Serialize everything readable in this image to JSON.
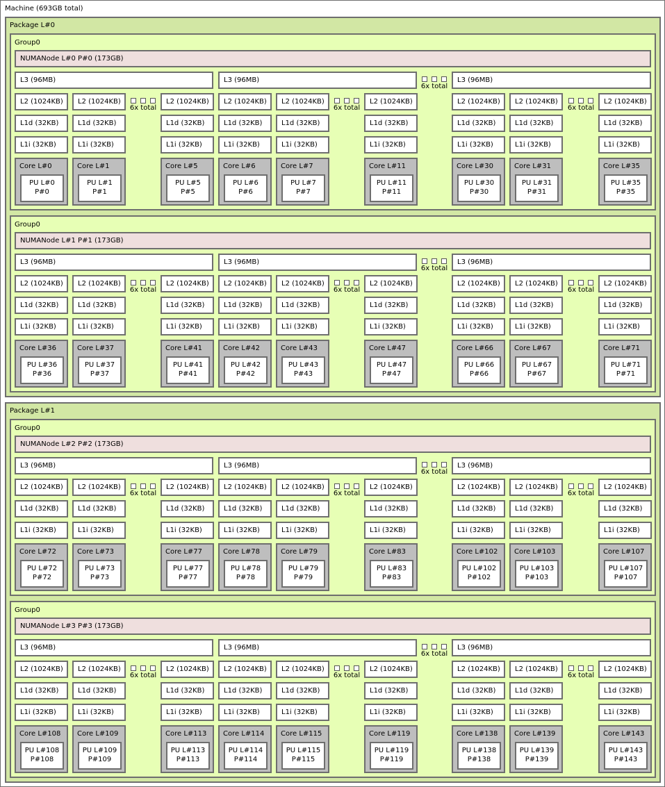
{
  "machine": {
    "label": "Machine (693GB total)"
  },
  "colors": {
    "package_bg": "#d2e7a4",
    "group_bg": "#e7ffb5",
    "numa_bg": "#efdfde",
    "core_bg": "#bebebe",
    "cache_bg": "#ffffff",
    "border": "#6e6e6e"
  },
  "ellipsis_label": "6x total",
  "packages": [
    {
      "label": "Package L#0",
      "groups": [
        {
          "label": "Group0",
          "numa": "NUMANode L#0 P#0 (173GB)",
          "l3": [
            "L3 (96MB)",
            "L3 (96MB)",
            "L3 (96MB)"
          ],
          "l2": "L2 (1024KB)",
          "l1d": "L1d (32KB)",
          "l1i": "L1i (32KB)",
          "cores": [
            {
              "core": "Core L#0",
              "pu": "PU L#0",
              "p": "P#0"
            },
            {
              "core": "Core L#1",
              "pu": "PU L#1",
              "p": "P#1"
            },
            {
              "core": "Core L#5",
              "pu": "PU L#5",
              "p": "P#5"
            },
            {
              "core": "Core L#6",
              "pu": "PU L#6",
              "p": "P#6"
            },
            {
              "core": "Core L#7",
              "pu": "PU L#7",
              "p": "P#7"
            },
            {
              "core": "Core L#11",
              "pu": "PU L#11",
              "p": "P#11"
            },
            {
              "core": "Core L#30",
              "pu": "PU L#30",
              "p": "P#30"
            },
            {
              "core": "Core L#31",
              "pu": "PU L#31",
              "p": "P#31"
            },
            {
              "core": "Core L#35",
              "pu": "PU L#35",
              "p": "P#35"
            }
          ]
        },
        {
          "label": "Group0",
          "numa": "NUMANode L#1 P#1 (173GB)",
          "l3": [
            "L3 (96MB)",
            "L3 (96MB)",
            "L3 (96MB)"
          ],
          "l2": "L2 (1024KB)",
          "l1d": "L1d (32KB)",
          "l1i": "L1i (32KB)",
          "cores": [
            {
              "core": "Core L#36",
              "pu": "PU L#36",
              "p": "P#36"
            },
            {
              "core": "Core L#37",
              "pu": "PU L#37",
              "p": "P#37"
            },
            {
              "core": "Core L#41",
              "pu": "PU L#41",
              "p": "P#41"
            },
            {
              "core": "Core L#42",
              "pu": "PU L#42",
              "p": "P#42"
            },
            {
              "core": "Core L#43",
              "pu": "PU L#43",
              "p": "P#43"
            },
            {
              "core": "Core L#47",
              "pu": "PU L#47",
              "p": "P#47"
            },
            {
              "core": "Core L#66",
              "pu": "PU L#66",
              "p": "P#66"
            },
            {
              "core": "Core L#67",
              "pu": "PU L#67",
              "p": "P#67"
            },
            {
              "core": "Core L#71",
              "pu": "PU L#71",
              "p": "P#71"
            }
          ]
        }
      ]
    },
    {
      "label": "Package L#1",
      "groups": [
        {
          "label": "Group0",
          "numa": "NUMANode L#2 P#2 (173GB)",
          "l3": [
            "L3 (96MB)",
            "L3 (96MB)",
            "L3 (96MB)"
          ],
          "l2": "L2 (1024KB)",
          "l1d": "L1d (32KB)",
          "l1i": "L1i (32KB)",
          "cores": [
            {
              "core": "Core L#72",
              "pu": "PU L#72",
              "p": "P#72"
            },
            {
              "core": "Core L#73",
              "pu": "PU L#73",
              "p": "P#73"
            },
            {
              "core": "Core L#77",
              "pu": "PU L#77",
              "p": "P#77"
            },
            {
              "core": "Core L#78",
              "pu": "PU L#78",
              "p": "P#78"
            },
            {
              "core": "Core L#79",
              "pu": "PU L#79",
              "p": "P#79"
            },
            {
              "core": "Core L#83",
              "pu": "PU L#83",
              "p": "P#83"
            },
            {
              "core": "Core L#102",
              "pu": "PU L#102",
              "p": "P#102"
            },
            {
              "core": "Core L#103",
              "pu": "PU L#103",
              "p": "P#103"
            },
            {
              "core": "Core L#107",
              "pu": "PU L#107",
              "p": "P#107"
            }
          ]
        },
        {
          "label": "Group0",
          "numa": "NUMANode L#3 P#3 (173GB)",
          "l3": [
            "L3 (96MB)",
            "L3 (96MB)",
            "L3 (96MB)"
          ],
          "l2": "L2 (1024KB)",
          "l1d": "L1d (32KB)",
          "l1i": "L1i (32KB)",
          "cores": [
            {
              "core": "Core L#108",
              "pu": "PU L#108",
              "p": "P#108"
            },
            {
              "core": "Core L#109",
              "pu": "PU L#109",
              "p": "P#109"
            },
            {
              "core": "Core L#113",
              "pu": "PU L#113",
              "p": "P#113"
            },
            {
              "core": "Core L#114",
              "pu": "PU L#114",
              "p": "P#114"
            },
            {
              "core": "Core L#115",
              "pu": "PU L#115",
              "p": "P#115"
            },
            {
              "core": "Core L#119",
              "pu": "PU L#119",
              "p": "P#119"
            },
            {
              "core": "Core L#138",
              "pu": "PU L#138",
              "p": "P#138"
            },
            {
              "core": "Core L#139",
              "pu": "PU L#139",
              "p": "P#139"
            },
            {
              "core": "Core L#143",
              "pu": "PU L#143",
              "p": "P#143"
            }
          ]
        }
      ]
    }
  ]
}
